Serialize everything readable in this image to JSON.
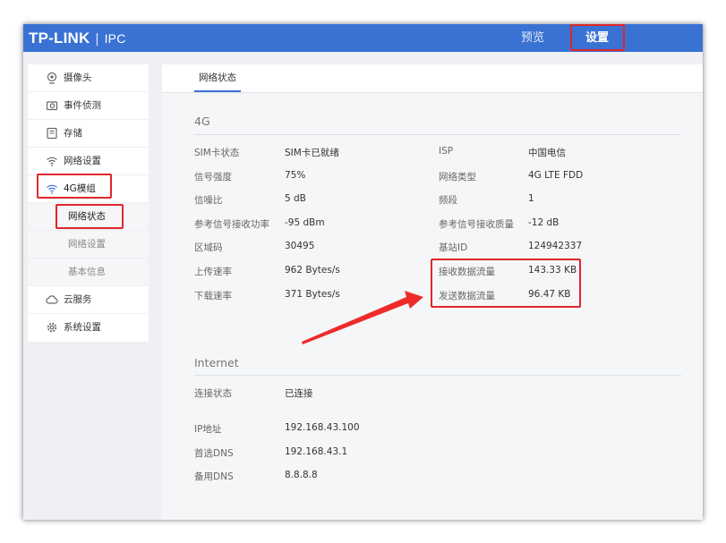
{
  "header": {
    "brand": "TP-LINK",
    "separator": "|",
    "product": "IPC",
    "nav_preview": "预览",
    "nav_settings": "设置"
  },
  "sidebar": {
    "items": [
      {
        "label": "摄像头",
        "icon": "camera-icon"
      },
      {
        "label": "事件侦测",
        "icon": "event-detect-icon"
      },
      {
        "label": "存储",
        "icon": "storage-icon"
      },
      {
        "label": "网络设置",
        "icon": "wifi-icon"
      },
      {
        "label": "4G模组",
        "icon": "wifi-4g-icon"
      }
    ],
    "sub_items": [
      {
        "label": "网络状态"
      },
      {
        "label": "网络设置"
      },
      {
        "label": "基本信息"
      }
    ],
    "bottom_items": [
      {
        "label": "云服务",
        "icon": "cloud-icon"
      },
      {
        "label": "系统设置",
        "icon": "gear-icon"
      }
    ]
  },
  "tabs": {
    "active": "网络状态"
  },
  "section_4g": {
    "title": "4G",
    "left": [
      {
        "label": "SIM卡状态",
        "value": "SIM卡已就绪"
      },
      {
        "label": "信号强度",
        "value": "75%"
      },
      {
        "label": "信噪比",
        "value": "5 dB"
      },
      {
        "label": "参考信号接收功率",
        "value": "-95 dBm"
      },
      {
        "label": "区域码",
        "value": "30495"
      },
      {
        "label": "上传速率",
        "value": "962 Bytes/s"
      },
      {
        "label": "下载速率",
        "value": "371 Bytes/s"
      }
    ],
    "right": [
      {
        "label": "ISP",
        "value": "中国电信"
      },
      {
        "label": "网络类型",
        "value": "4G LTE FDD"
      },
      {
        "label": "频段",
        "value": "1"
      },
      {
        "label": "参考信号接收质量",
        "value": "-12 dB"
      },
      {
        "label": "基站ID",
        "value": "124942337"
      },
      {
        "label": "接收数据流量",
        "value": "143.33 KB"
      },
      {
        "label": "发送数据流量",
        "value": "96.47 KB"
      }
    ]
  },
  "section_internet": {
    "title": "Internet",
    "rows": [
      {
        "label": "连接状态",
        "value": "已连接"
      },
      {
        "label": "IP地址",
        "value": "192.168.43.100"
      },
      {
        "label": "首选DNS",
        "value": "192.168.43.1"
      },
      {
        "label": "备用DNS",
        "value": "8.8.8.8"
      }
    ]
  },
  "colors": {
    "header": "#3a72d4",
    "highlight": "#e0262a",
    "arrow": "#ee2b2b"
  }
}
